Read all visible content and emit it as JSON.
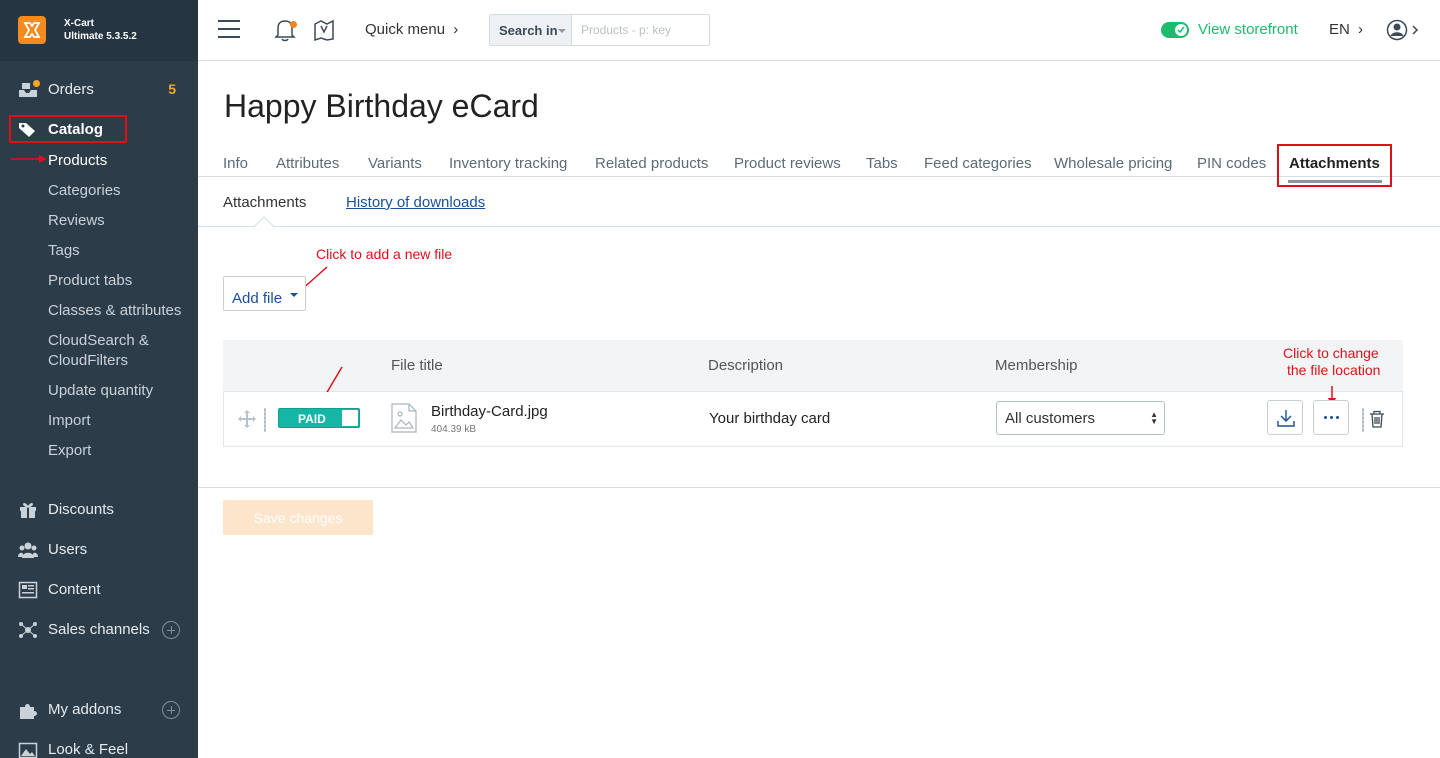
{
  "brand": {
    "name": "X-Cart",
    "version": "Ultimate 5.3.5.2"
  },
  "sidebar": {
    "orders": {
      "label": "Orders",
      "count": "5"
    },
    "catalog": {
      "label": "Catalog"
    },
    "catalog_items": [
      "Products",
      "Categories",
      "Reviews",
      "Tags",
      "Product tabs",
      "Classes & attributes",
      "CloudSearch &",
      "CloudFilters",
      "Update quantity",
      "Import",
      "Export"
    ],
    "discounts": "Discounts",
    "users": "Users",
    "content": "Content",
    "sales_channels": "Sales channels",
    "my_addons": "My addons",
    "look_feel": "Look & Feel"
  },
  "topbar": {
    "quick_menu": "Quick menu",
    "search_in": "Search in",
    "search_placeholder": "Products - p: key",
    "view_storefront": "View storefront",
    "language": "EN"
  },
  "page": {
    "title": "Happy Birthday eCard",
    "tabs": [
      "Info",
      "Attributes",
      "Variants",
      "Inventory tracking",
      "Related products",
      "Product reviews",
      "Tabs",
      "Feed categories",
      "Wholesale pricing",
      "PIN codes",
      "Attachments"
    ],
    "active_tab": "Attachments",
    "subtabs": {
      "active": "Attachments",
      "link": "History of downloads"
    },
    "add_file": "Add file",
    "table": {
      "headers": {
        "file_title": "File title",
        "description": "Description",
        "membership": "Membership"
      },
      "rows": [
        {
          "paid_label": "PAID",
          "file_name": "Birthday-Card.jpg",
          "file_size": "404.39 kB",
          "description": "Your birthday card",
          "membership": "All customers"
        }
      ]
    },
    "save_button": "Save changes"
  },
  "annotations": {
    "add_file_hint": "Click to add a new file",
    "change_location_1": "Click to change",
    "change_location_2": "the file location"
  },
  "colors": {
    "sidebar_bg": "#2c3c49",
    "accent_orange": "#f58a1f",
    "storefront_green": "#1cbb6e",
    "link_blue": "#1a4f9c",
    "annotation_red": "#e0101a",
    "paid_teal": "#15b6a5"
  }
}
